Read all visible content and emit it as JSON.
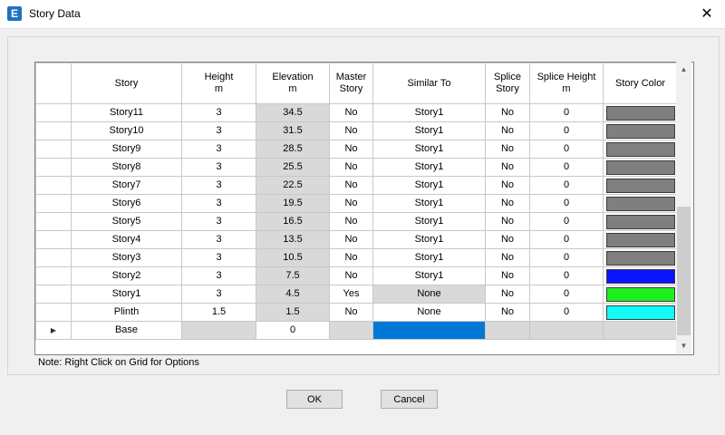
{
  "window": {
    "title": "Story Data",
    "app_icon_letter": "E",
    "close_glyph": "✕"
  },
  "columns": [
    {
      "line1": "Story",
      "line2": ""
    },
    {
      "line1": "Height",
      "line2": "m"
    },
    {
      "line1": "Elevation",
      "line2": "m"
    },
    {
      "line1": "Master",
      "line2": "Story"
    },
    {
      "line1": "Similar To",
      "line2": ""
    },
    {
      "line1": "Splice",
      "line2": "Story"
    },
    {
      "line1": "Splice Height",
      "line2": "m"
    },
    {
      "line1": "Story Color",
      "line2": ""
    }
  ],
  "rows": [
    {
      "story": "Story11",
      "height": "3",
      "elevation": "34.5",
      "master": "No",
      "similar": "Story1",
      "splice": "No",
      "splice_height": "0",
      "color": "#7f7f7f"
    },
    {
      "story": "Story10",
      "height": "3",
      "elevation": "31.5",
      "master": "No",
      "similar": "Story1",
      "splice": "No",
      "splice_height": "0",
      "color": "#7f7f7f"
    },
    {
      "story": "Story9",
      "height": "3",
      "elevation": "28.5",
      "master": "No",
      "similar": "Story1",
      "splice": "No",
      "splice_height": "0",
      "color": "#7f7f7f"
    },
    {
      "story": "Story8",
      "height": "3",
      "elevation": "25.5",
      "master": "No",
      "similar": "Story1",
      "splice": "No",
      "splice_height": "0",
      "color": "#7f7f7f"
    },
    {
      "story": "Story7",
      "height": "3",
      "elevation": "22.5",
      "master": "No",
      "similar": "Story1",
      "splice": "No",
      "splice_height": "0",
      "color": "#7f7f7f"
    },
    {
      "story": "Story6",
      "height": "3",
      "elevation": "19.5",
      "master": "No",
      "similar": "Story1",
      "splice": "No",
      "splice_height": "0",
      "color": "#7f7f7f"
    },
    {
      "story": "Story5",
      "height": "3",
      "elevation": "16.5",
      "master": "No",
      "similar": "Story1",
      "splice": "No",
      "splice_height": "0",
      "color": "#7f7f7f"
    },
    {
      "story": "Story4",
      "height": "3",
      "elevation": "13.5",
      "master": "No",
      "similar": "Story1",
      "splice": "No",
      "splice_height": "0",
      "color": "#7f7f7f"
    },
    {
      "story": "Story3",
      "height": "3",
      "elevation": "10.5",
      "master": "No",
      "similar": "Story1",
      "splice": "No",
      "splice_height": "0",
      "color": "#7f7f7f"
    },
    {
      "story": "Story2",
      "height": "3",
      "elevation": "7.5",
      "master": "No",
      "similar": "Story1",
      "splice": "No",
      "splice_height": "0",
      "color": "#0a14ff"
    },
    {
      "story": "Story1",
      "height": "3",
      "elevation": "4.5",
      "master": "Yes",
      "similar": "None",
      "splice": "No",
      "splice_height": "0",
      "color": "#1ef01e",
      "similar_gray": true
    },
    {
      "story": "Plinth",
      "height": "1.5",
      "elevation": "1.5",
      "master": "No",
      "similar": "None",
      "splice": "No",
      "splice_height": "0",
      "color": "#14fafa"
    }
  ],
  "base_row": {
    "story": "Base",
    "elevation": "0"
  },
  "note": "Note:  Right Click on Grid for Options",
  "buttons": {
    "ok": "OK",
    "cancel": "Cancel"
  }
}
